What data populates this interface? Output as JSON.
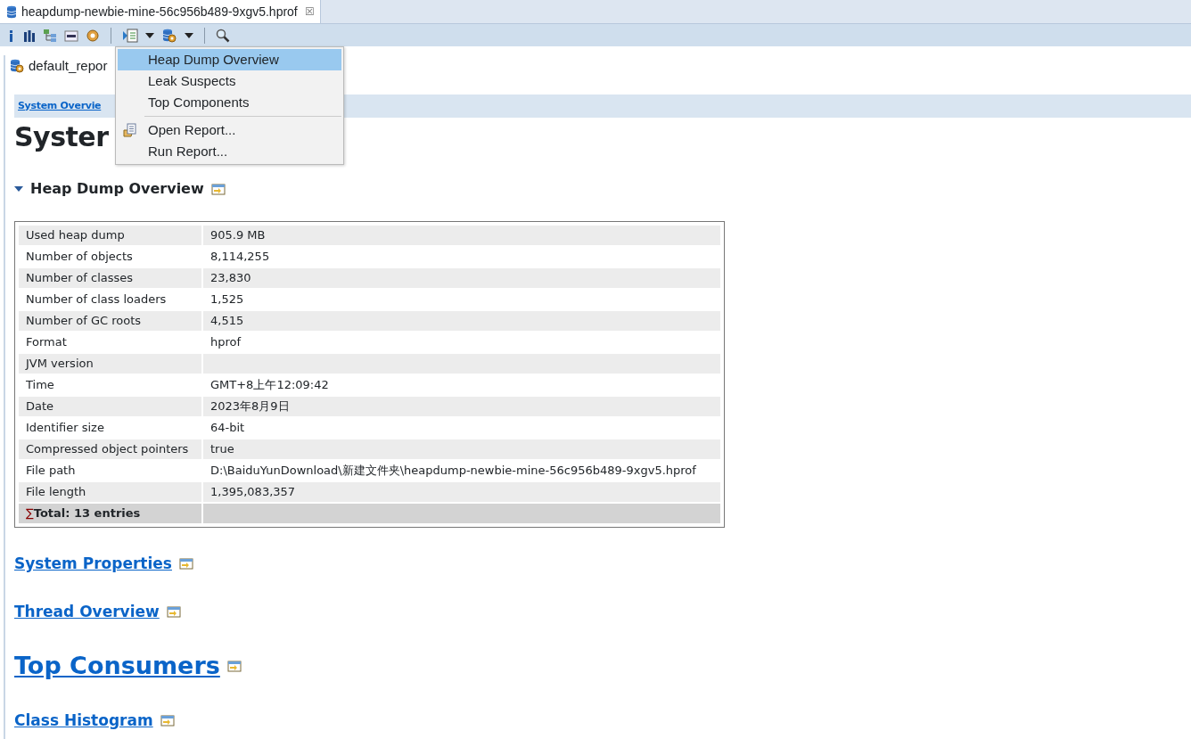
{
  "editor_tab": {
    "title": "heapdump-newbie-mine-56c956b489-9xgv5.hprof",
    "close": "☒"
  },
  "report_tab": {
    "title": "default_repor"
  },
  "breadcrumb": {
    "link": "System Overvie"
  },
  "page_title": "Syster",
  "section": {
    "title": "Heap Dump Overview",
    "expanded": true
  },
  "table": {
    "rows": [
      {
        "label": "Used heap dump",
        "value": "905.9 MB"
      },
      {
        "label": "Number of objects",
        "value": "8,114,255"
      },
      {
        "label": "Number of classes",
        "value": "23,830"
      },
      {
        "label": "Number of class loaders",
        "value": "1,525"
      },
      {
        "label": "Number of GC roots",
        "value": "4,515"
      },
      {
        "label": "Format",
        "value": "hprof"
      },
      {
        "label": "JVM version",
        "value": ""
      },
      {
        "label": "Time",
        "value": "GMT+8上午12:09:42"
      },
      {
        "label": "Date",
        "value": "2023年8月9日"
      },
      {
        "label": "Identifier size",
        "value": "64-bit"
      },
      {
        "label": "Compressed object pointers",
        "value": "true"
      },
      {
        "label": "File path",
        "value": "D:\\BaiduYunDownload\\新建文件夹\\heapdump-newbie-mine-56c956b489-9xgv5.hprof"
      },
      {
        "label": "File length",
        "value": "1,395,083,357"
      }
    ],
    "total": {
      "sigma": "∑",
      "label": "Total: 13 entries"
    }
  },
  "links": [
    {
      "text": "System Properties",
      "kind": "normal"
    },
    {
      "text": "Thread Overview",
      "kind": "normal"
    },
    {
      "text": "Top Consumers",
      "kind": "large"
    },
    {
      "text": "Class Histogram",
      "kind": "normal"
    }
  ],
  "menu": {
    "groups": [
      [
        {
          "label": "Heap Dump Overview",
          "selected": true,
          "kind": "plain"
        },
        {
          "label": "Leak Suspects",
          "selected": false,
          "kind": "plain"
        },
        {
          "label": "Top Components",
          "selected": false,
          "kind": "plain"
        }
      ],
      [
        {
          "label": "Open Report...",
          "selected": false,
          "kind": "report-icon"
        },
        {
          "label": "Run Report...",
          "selected": false,
          "kind": "plain"
        }
      ]
    ]
  }
}
